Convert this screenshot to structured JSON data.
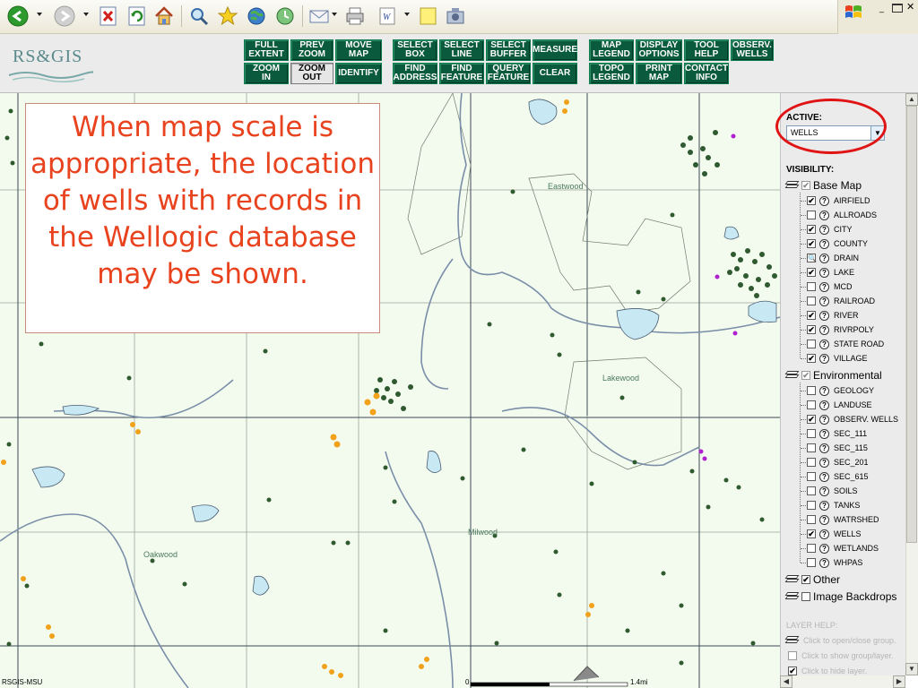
{
  "browser": {
    "toolbar_icons": [
      "back-arrow-icon",
      "forward-arrow-icon",
      "stop-icon",
      "refresh-icon",
      "home-icon",
      "search-icon",
      "favorites-star-icon",
      "media-globe-icon",
      "history-icon",
      "mail-icon",
      "print-icon",
      "edit-word-icon",
      "discuss-note-icon",
      "messenger-icon"
    ],
    "window_logo": "windows-flag-icon"
  },
  "app": {
    "logo": "RS&GIS",
    "toolbar": [
      {
        "id": "full-extent",
        "label": "FULL\nEXTENT"
      },
      {
        "id": "prev-zoom",
        "label": "PREV\nZOOM"
      },
      {
        "id": "move-map",
        "label": "MOVE\nMAP"
      },
      {
        "id": "select-box",
        "label": "SELECT\nBOX"
      },
      {
        "id": "select-line",
        "label": "SELECT\nLINE"
      },
      {
        "id": "select-buffer",
        "label": "SELECT\nBUFFER"
      },
      {
        "id": "measure",
        "label": "MEASURE"
      },
      {
        "id": "map-legend",
        "label": "MAP\nLEGEND"
      },
      {
        "id": "display-options",
        "label": "DISPLAY\nOPTIONS"
      },
      {
        "id": "tool-help",
        "label": "TOOL\nHELP"
      },
      {
        "id": "observ-wells",
        "label": "OBSERV.\nWELLS"
      },
      {
        "id": "zoom-in",
        "label": "ZOOM\nIN"
      },
      {
        "id": "zoom-out",
        "label": "ZOOM\nOUT"
      },
      {
        "id": "identify",
        "label": "IDENTIFY"
      },
      {
        "id": "find-address",
        "label": "FIND\nADDRESS"
      },
      {
        "id": "find-feature",
        "label": "FIND\nFEATURE"
      },
      {
        "id": "query-feature",
        "label": "QUERY\nFEATURE"
      },
      {
        "id": "clear",
        "label": "CLEAR"
      },
      {
        "id": "topo-legend",
        "label": "TOPO\nLEGEND"
      },
      {
        "id": "print-map",
        "label": "PRINT\nMAP"
      },
      {
        "id": "contact-info",
        "label": "CONTACT\nINFO"
      }
    ],
    "selected_tool": "zoom-out"
  },
  "map": {
    "callout": "When map scale is appropriate, the location of wells with records in the Wellogic database may be shown.",
    "places": [
      "Eastwood",
      "Lakewood",
      "Oakwood",
      "Milwood"
    ],
    "scale_start": "0",
    "scale_end": "1.4mi",
    "credit": "RSGIS-MSU",
    "colors": {
      "background": "#f3fbef",
      "wells": "#2f5a2f",
      "observation_wells": "#f2a21a",
      "special": "#b020d0",
      "water": "#c8e8f4",
      "roads": "#6a7a88"
    }
  },
  "panel": {
    "active_label": "ACTIVE:",
    "active_value": "WELLS",
    "visibility_label": "VISIBILITY:",
    "groups": [
      {
        "name": "Base Map",
        "checked": true,
        "grayed": true,
        "layers": [
          {
            "name": "AIRFIELD",
            "checked": true
          },
          {
            "name": "ALLROADS",
            "checked": false
          },
          {
            "name": "CITY",
            "checked": true
          },
          {
            "name": "COUNTY",
            "checked": true
          },
          {
            "name": "DRAIN",
            "checked": false,
            "icon": "magnifier"
          },
          {
            "name": "LAKE",
            "checked": true
          },
          {
            "name": "MCD",
            "checked": false
          },
          {
            "name": "RAILROAD",
            "checked": false
          },
          {
            "name": "RIVER",
            "checked": true
          },
          {
            "name": "RIVRPOLY",
            "checked": true
          },
          {
            "name": "STATE ROAD",
            "checked": false
          },
          {
            "name": "VILLAGE",
            "checked": true
          }
        ]
      },
      {
        "name": "Environmental",
        "checked": true,
        "grayed": true,
        "layers": [
          {
            "name": "GEOLOGY",
            "checked": false
          },
          {
            "name": "LANDUSE",
            "checked": false
          },
          {
            "name": "OBSERV. WELLS",
            "checked": true
          },
          {
            "name": "SEC_111",
            "checked": false
          },
          {
            "name": "SEC_115",
            "checked": false
          },
          {
            "name": "SEC_201",
            "checked": false
          },
          {
            "name": "SEC_615",
            "checked": false
          },
          {
            "name": "SOILS",
            "checked": false
          },
          {
            "name": "TANKS",
            "checked": false
          },
          {
            "name": "WATRSHED",
            "checked": false
          },
          {
            "name": "WELLS",
            "checked": true
          },
          {
            "name": "WETLANDS",
            "checked": false
          },
          {
            "name": "WHPAS",
            "checked": false
          }
        ]
      },
      {
        "name": "Other",
        "checked": true,
        "grayed": false,
        "layers": []
      },
      {
        "name": "Image Backdrops",
        "checked": false,
        "grayed": false,
        "layers": []
      }
    ],
    "help_title": "LAYER HELP:",
    "help_lines": [
      "Click to open/close group.",
      "Click to show group/layer.",
      "Click to hide layer."
    ]
  }
}
